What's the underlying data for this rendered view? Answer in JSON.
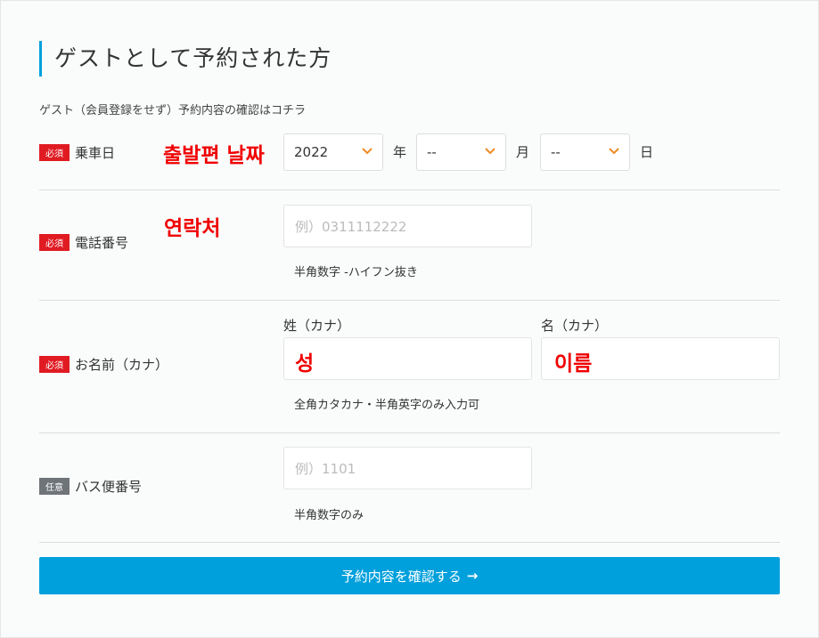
{
  "heading": "ゲストとして予約された方",
  "note": "ゲスト（会員登録をせず）予約内容の確認はコチラ",
  "badges": {
    "required": "必須",
    "optional": "任意"
  },
  "ride_date": {
    "label": "乗車日",
    "annotation": "출발편 날짜",
    "year": {
      "value": "2022",
      "unit": "年"
    },
    "month": {
      "value": "--",
      "unit": "月"
    },
    "day": {
      "value": "--",
      "unit": "日"
    }
  },
  "phone": {
    "label": "電話番号",
    "annotation": "연락처",
    "placeholder": "例）0311112222",
    "hint": "半角数字 -ハイフン抜き"
  },
  "name": {
    "label": "お名前（カナ）",
    "last_label": "姓（カナ）",
    "first_label": "名（カナ）",
    "last_annotation": "성",
    "first_annotation": "이름",
    "hint": "全角カタカナ・半角英字のみ入力可"
  },
  "bus_number": {
    "label": "バス便番号",
    "placeholder": "例）1101",
    "hint": "半角数字のみ"
  },
  "submit": {
    "label": "予約内容を確認する",
    "arrow": "→"
  },
  "colors": {
    "accent": "#00a0dc",
    "required": "#e01b22",
    "optional": "#6f7479",
    "annotation": "#f00000",
    "chevron": "#f08a24"
  }
}
